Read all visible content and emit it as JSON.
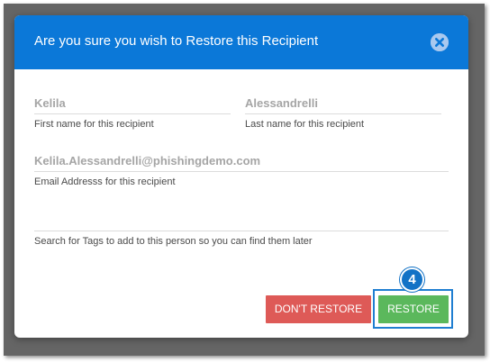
{
  "dialog": {
    "title": "Are you sure you wish to Restore this Recipient",
    "close_icon": "close-circle-icon"
  },
  "form": {
    "first_name": {
      "value": "Kelila",
      "help": "First name for this recipient"
    },
    "last_name": {
      "value": "Alessandrelli",
      "help": "Last name for this recipient"
    },
    "email": {
      "value": "Kelila.Alessandrelli@phishingdemo.com",
      "help": "Email Addresss for this recipient"
    },
    "tags": {
      "value": "",
      "help": "Search for Tags to add to this person so you can find them later"
    }
  },
  "actions": {
    "dont_restore_label": "DON'T RESTORE",
    "restore_label": "RESTORE"
  },
  "annotation": {
    "step_number": "4"
  },
  "colors": {
    "header": "#0b78d8",
    "danger": "#de5a57",
    "success": "#5bb85c",
    "highlight": "#1f7ed1"
  }
}
